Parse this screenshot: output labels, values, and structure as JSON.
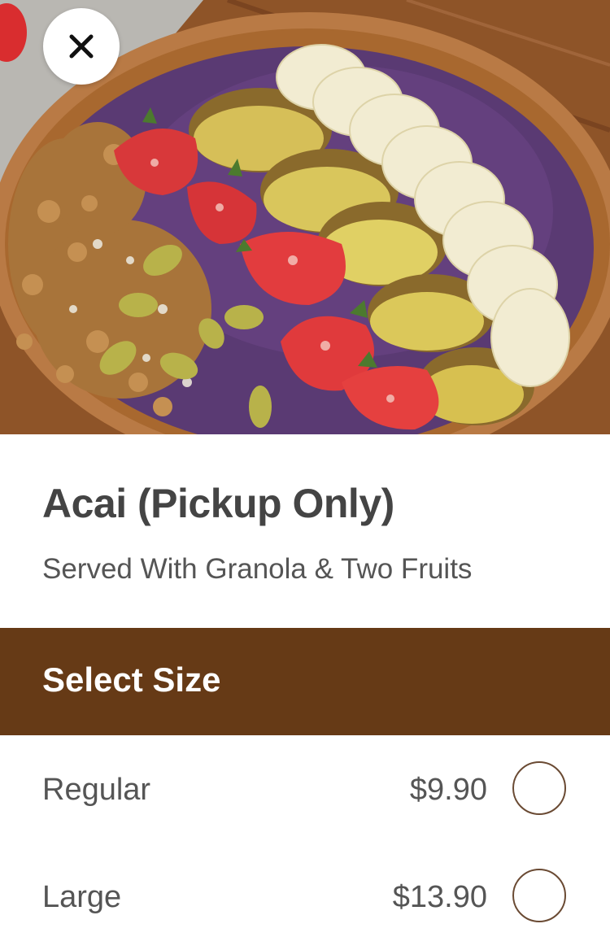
{
  "product": {
    "image": "acai-bowl-photo",
    "title": "Acai (Pickup Only)",
    "description": "Served With Granola & Two Fruits"
  },
  "close_icon": "close-icon",
  "size_section": {
    "header": "Select Size",
    "options": [
      {
        "label": "Regular",
        "price": "$9.90",
        "selected": false
      },
      {
        "label": "Large",
        "price": "$13.90",
        "selected": false
      }
    ]
  },
  "colors": {
    "header_bg": "#663a16",
    "text": "#555555",
    "title": "#444444"
  }
}
